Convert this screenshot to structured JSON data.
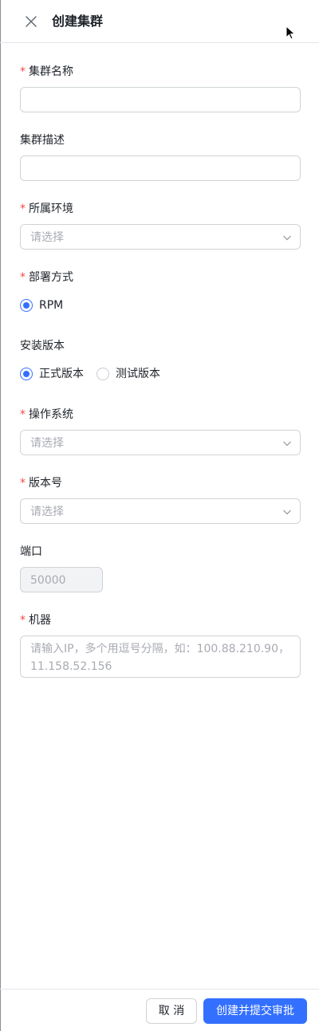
{
  "header": {
    "title": "创建集群",
    "close_icon": "close-icon"
  },
  "fields": {
    "cluster_name": {
      "required": "*",
      "label": "集群名称",
      "value": ""
    },
    "cluster_desc": {
      "label": "集群描述",
      "value": ""
    },
    "environment": {
      "required": "*",
      "label": "所属环境",
      "placeholder": "请选择"
    },
    "deploy_mode": {
      "required": "*",
      "label": "部署方式",
      "options": [
        {
          "label": "RPM",
          "selected": true
        }
      ]
    },
    "install_version": {
      "label": "安装版本",
      "options": [
        {
          "label": "正式版本",
          "selected": true
        },
        {
          "label": "测试版本",
          "selected": false
        }
      ]
    },
    "os": {
      "required": "*",
      "label": "操作系统",
      "placeholder": "请选择"
    },
    "version_no": {
      "required": "*",
      "label": "版本号",
      "placeholder": "请选择"
    },
    "port": {
      "label": "端口",
      "placeholder": "50000"
    },
    "machines": {
      "required": "*",
      "label": "机器",
      "placeholder": "请输入IP，多个用逗号分隔，如：100.88.210.90，11.158.52.156"
    }
  },
  "footer": {
    "cancel_label": "取 消",
    "submit_label": "创建并提交审批"
  },
  "colors": {
    "primary": "#3370ff",
    "required": "#f54a45",
    "border": "#d0d3d6",
    "placeholder": "#a8abb2"
  }
}
